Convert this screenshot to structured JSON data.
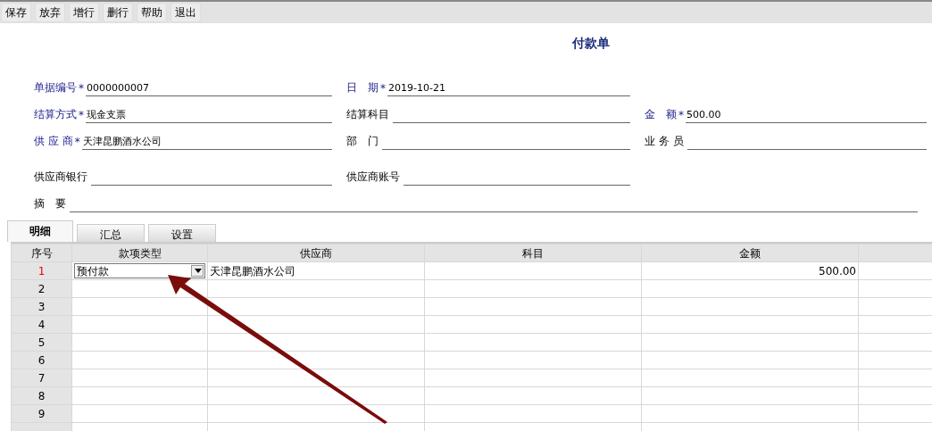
{
  "toolbar": [
    "保存",
    "放弃",
    "增行",
    "删行",
    "帮助",
    "退出"
  ],
  "title": "付款单",
  "form_rows": [
    [
      {
        "label": "单据编号",
        "required": true,
        "mark": "*",
        "value": "0000000007"
      },
      {
        "label": "日　期",
        "required": true,
        "mark": "*",
        "value": "2019-10-21"
      }
    ],
    [
      {
        "label": "结算方式",
        "required": true,
        "mark": "*",
        "value": "现金支票"
      },
      {
        "label": "结算科目",
        "required": false
      },
      {
        "label": "金　额",
        "required": true,
        "mark": "*",
        "value": "500.00"
      }
    ],
    [
      {
        "label": "供 应 商",
        "required": true,
        "mark": "*",
        "value": "天津昆鹏酒水公司"
      },
      {
        "label": "部　门",
        "required": false
      },
      {
        "label": "业 务 员",
        "required": false
      }
    ],
    [
      {
        "label": "供应商银行",
        "required": false
      },
      {
        "label": "供应商账号",
        "required": false
      }
    ],
    [
      {
        "label": "摘　要",
        "required": false
      }
    ]
  ],
  "tabs": [
    {
      "label": "明细",
      "selected": true
    },
    {
      "label": "汇总",
      "selected": false
    },
    {
      "label": "设置",
      "selected": false
    }
  ],
  "table": {
    "columns": [
      "序号",
      "款项类型",
      "供应商",
      "科目",
      "金额"
    ],
    "rows": [
      {
        "no": "1",
        "current": true,
        "type": "预付款",
        "dropdown": true,
        "supplier": "天津昆鹏酒水公司",
        "amount": "500.00"
      },
      {
        "no": "2",
        "current": false
      },
      {
        "no": "3",
        "current": false
      },
      {
        "no": "4",
        "current": false
      },
      {
        "no": "5",
        "current": false
      },
      {
        "no": "6",
        "current": false
      },
      {
        "no": "7",
        "current": false
      },
      {
        "no": "8",
        "current": false
      },
      {
        "no": "9",
        "current": false
      }
    ]
  }
}
